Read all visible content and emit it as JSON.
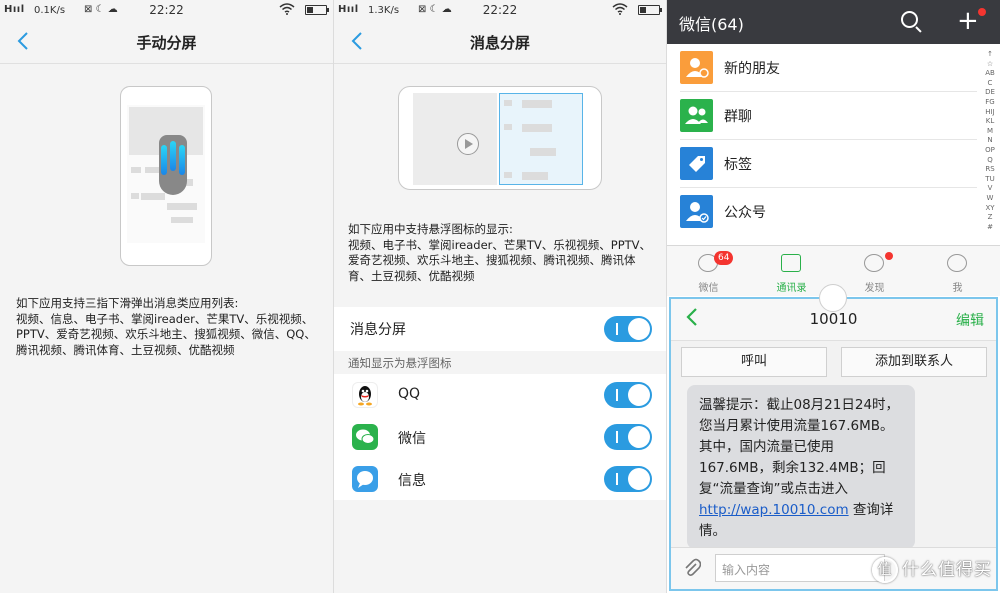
{
  "panel1": {
    "status": {
      "signal": "Hııl",
      "speed": "0.1K/s",
      "icons": "⊠ ☾ ☁",
      "time": "22:22"
    },
    "title": "手动分屏",
    "description_heading": "如下应用支持三指下滑弹出消息类应用列表:",
    "description_body": "视频、信息、电子书、掌阅ireader、芒果TV、乐视视频、PPTV、爱奇艺视频、欢乐斗地主、搜狐视频、微信、QQ、腾讯视频、腾讯体育、土豆视频、优酷视频"
  },
  "panel2": {
    "status": {
      "signal": "Hııl",
      "speed": "1.3K/s",
      "icons": "⊠ ☾ ☁",
      "time": "22:22"
    },
    "title": "消息分屏",
    "description_heading": "如下应用中支持悬浮图标的显示:",
    "description_body": "视频、电子书、掌阅ireader、芒果TV、乐视视频、PPTV、爱奇艺视频、欢乐斗地主、搜狐视频、腾讯视频、腾讯体育、土豆视频、优酷视频",
    "main_toggle_label": "消息分屏",
    "section_label": "通知显示为悬浮图标",
    "apps": [
      {
        "name": "QQ",
        "icon": "qq-icon",
        "enabled": true
      },
      {
        "name": "微信",
        "icon": "wechat-icon",
        "enabled": true
      },
      {
        "name": "信息",
        "icon": "message-icon",
        "enabled": true
      }
    ]
  },
  "panel3": {
    "header_title": "微信(64)",
    "contacts": [
      {
        "label": "新的朋友",
        "icon": "new-friend-icon",
        "color": "#fa9d3b"
      },
      {
        "label": "群聊",
        "icon": "group-chat-icon",
        "color": "#2bb24c"
      },
      {
        "label": "标签",
        "icon": "tag-icon",
        "color": "#2782d7"
      },
      {
        "label": "公众号",
        "icon": "official-account-icon",
        "color": "#2782d7"
      }
    ],
    "alphabet": "↑☆ABCDEFGHIJKLMNOPQRSTUVWXYZ#",
    "tabs": [
      {
        "label": "微信",
        "badge": "64",
        "active": false
      },
      {
        "label": "通讯录",
        "badge": "",
        "active": true
      },
      {
        "label": "发现",
        "badge": "dot",
        "active": false
      },
      {
        "label": "我",
        "badge": "",
        "active": false
      }
    ],
    "sms": {
      "number": "10010",
      "edit": "编辑",
      "call": "呼叫",
      "add_contact": "添加到联系人",
      "message_text": "温馨提示：截止08月21日24时，您当月累计使用流量167.6MB。其中，国内流量已使用167.6MB，剩余132.4MB；回复“流量查询”或点击进入",
      "message_link": "http://wap.10010.com",
      "message_tail": " 查询详情。",
      "input_placeholder": "输入内容"
    },
    "watermark": "什么值得买",
    "watermark_logo": "值"
  },
  "colors": {
    "accent_blue": "#2b9be0",
    "wechat_green": "#2ab04a",
    "wechat_header": "#393a3f",
    "badge_red": "#f43530"
  }
}
